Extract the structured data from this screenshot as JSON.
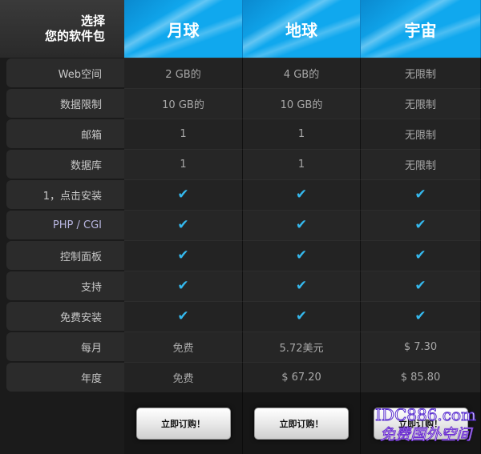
{
  "header": {
    "corner_line1": "选择",
    "corner_line2": "您的软件包",
    "plans": [
      "月球",
      "地球",
      "宇宙"
    ]
  },
  "rows": [
    {
      "label": "Web空间",
      "values": [
        "2 GB的",
        "4 GB的",
        "无限制"
      ]
    },
    {
      "label": "数据限制",
      "values": [
        "10 GB的",
        "10 GB的",
        "无限制"
      ]
    },
    {
      "label": "邮箱",
      "values": [
        "1",
        "1",
        "无限制"
      ]
    },
    {
      "label": "数据库",
      "values": [
        "1",
        "1",
        "无限制"
      ]
    },
    {
      "label": "1，点击安装",
      "values": [
        "check",
        "check",
        "check"
      ]
    },
    {
      "label": "PHP / CGI",
      "values": [
        "check",
        "check",
        "check"
      ]
    },
    {
      "label": "控制面板",
      "values": [
        "check",
        "check",
        "check"
      ]
    },
    {
      "label": "支持",
      "values": [
        "check",
        "check",
        "check"
      ]
    },
    {
      "label": "免费安装",
      "values": [
        "check",
        "check",
        "check"
      ]
    },
    {
      "label": "每月",
      "values": [
        "免费",
        "5.72美元",
        "$ 7.30"
      ]
    },
    {
      "label": "年度",
      "values": [
        "免费",
        "$ 67.20",
        "$ 85.80"
      ]
    }
  ],
  "check_glyph": "✔",
  "order_button_label": "立即订购！",
  "watermark": {
    "line1": "IDC886.com",
    "line2": "免费国外空间"
  },
  "colors": {
    "header_blue": "#10a8ee",
    "check_blue": "#35b9ee",
    "background": "#1b1b1b"
  }
}
